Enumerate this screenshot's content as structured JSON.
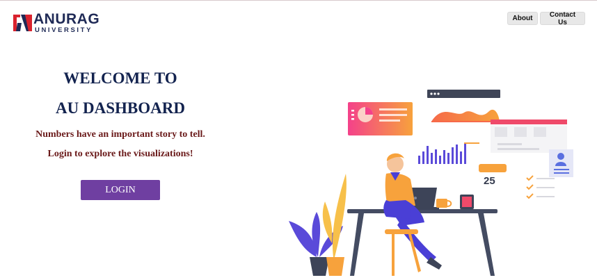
{
  "brand": {
    "name": "ANURAG",
    "sub": "UNIVERSITY",
    "accent_red": "#d9232e",
    "navy": "#1f2a56"
  },
  "nav": {
    "about_label": "About",
    "contact_label": "Contact Us"
  },
  "hero": {
    "title_line1": "WELCOME TO",
    "title_line2": "AU DASHBOARD",
    "subtitle1": "Numbers have an important story to tell.",
    "subtitle2": "Login to explore the visualizations!",
    "login_label": "LOGIN",
    "button_color": "#6f3fa1"
  },
  "illustration": {
    "counter_text": "25"
  }
}
